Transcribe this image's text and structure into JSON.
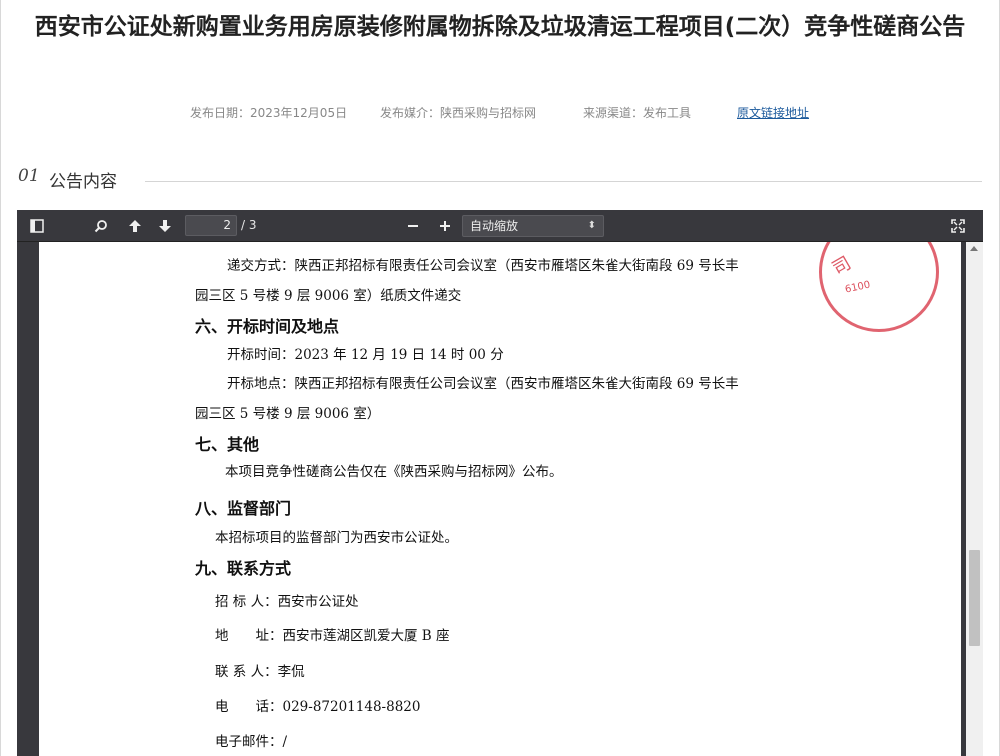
{
  "article": {
    "title": "西安市公证处新购置业务用房原装修附属物拆除及垃圾清运工程项目(二次）竞争性磋商公告",
    "meta": {
      "date": "发布日期：2023年12月05日",
      "media": "发布媒介：陕西采购与招标网",
      "channel": "来源渠道：发布工具",
      "source_link": "原文链接地址"
    },
    "section": {
      "num": "01",
      "label": "公告内容"
    }
  },
  "viewer": {
    "current_page": "2",
    "total_pages": "/ 3",
    "zoom": "自动缩放",
    "icons": [
      "sidebar-toggle-icon",
      "search-icon",
      "previous-page-icon",
      "next-page-icon",
      "zoom-out-icon",
      "zoom-in-icon",
      "fullscreen-icon"
    ]
  },
  "document": {
    "lines": [
      "递交方式：陕西正邦招标有限责任公司会议室（西安市雁塔区朱雀大街南段 69 号长丰",
      "园三区 5 号楼 9 层 9006 室）纸质文件递交",
      "六、开标时间及地点",
      "开标时间：2023 年 12 月 19 日 14 时 00 分",
      "开标地点：陕西正邦招标有限责任公司会议室（西安市雁塔区朱雀大街南段 69 号长丰",
      "园三区 5 号楼 9 层 9006 室）",
      "七、其他",
      "本项目竞争性磋商公告仅在《陕西采购与招标网》公布。",
      "八、监督部门",
      "本招标项目的监督部门为西安市公证处。",
      "九、联系方式",
      "招 标 人：西安市公证处",
      "地　　址：西安市莲湖区凯爱大厦 B 座",
      "联 系 人：李侃",
      "电　　话：029-87201148-8820",
      "电子邮件：/"
    ],
    "stamp_text": "6100",
    "stamp_char": "司"
  }
}
